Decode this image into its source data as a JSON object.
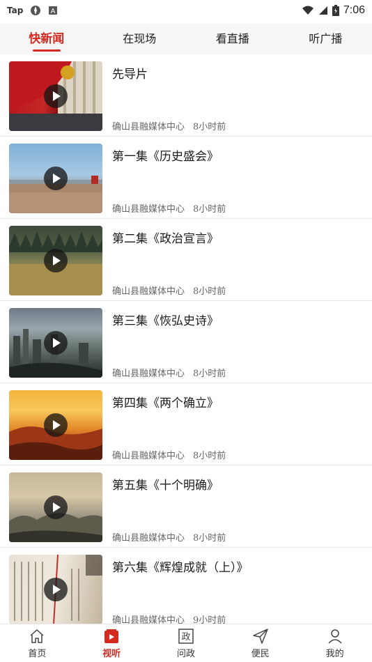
{
  "status_bar": {
    "left_text": "Tap",
    "time": "7:06"
  },
  "tabs": [
    {
      "label": "快新闻",
      "active": true
    },
    {
      "label": "在现场",
      "active": false
    },
    {
      "label": "看直播",
      "active": false
    },
    {
      "label": "听广播",
      "active": false
    }
  ],
  "items": [
    {
      "title": "先导片",
      "source": "确山县融媒体中心",
      "time": "8小时前"
    },
    {
      "title": "第一集《历史盛会》",
      "source": "确山县融媒体中心",
      "time": "8小时前"
    },
    {
      "title": "第二集《政治宣言》",
      "source": "确山县融媒体中心",
      "time": "8小时前"
    },
    {
      "title": "第三集《恢弘史诗》",
      "source": "确山县融媒体中心",
      "time": "8小时前"
    },
    {
      "title": "第四集《两个确立》",
      "source": "确山县融媒体中心",
      "time": "8小时前"
    },
    {
      "title": "第五集《十个明确》",
      "source": "确山县融媒体中心",
      "time": "8小时前"
    },
    {
      "title": "第六集《辉煌成就（上）》",
      "source": "确山县融媒体中心",
      "time": "9小时前"
    }
  ],
  "bottom_nav": [
    {
      "label": "首页",
      "icon": "home-icon",
      "active": false
    },
    {
      "label": "视听",
      "icon": "video-play-icon",
      "active": true
    },
    {
      "label": "问政",
      "icon": "politics-icon",
      "active": false
    },
    {
      "label": "便民",
      "icon": "send-icon",
      "active": false
    },
    {
      "label": "我的",
      "icon": "person-icon",
      "active": false
    }
  ],
  "accent_color": "#d42a20"
}
